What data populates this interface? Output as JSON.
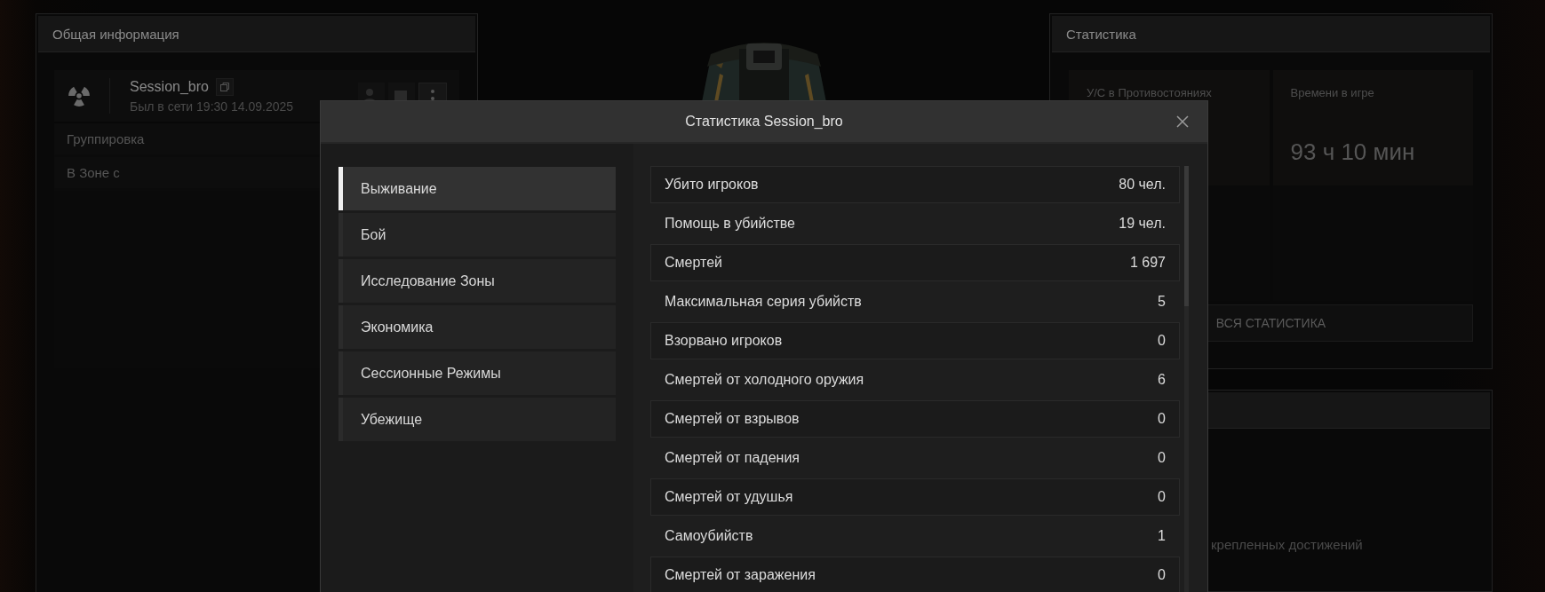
{
  "left_panel": {
    "title": "Общая информация",
    "profile": {
      "name": "Session_bro",
      "status": "Был в сети 19:30 14.09.2025"
    },
    "rows": [
      {
        "label": "Группировка"
      },
      {
        "label": "В Зоне с"
      }
    ]
  },
  "right_panel": {
    "title": "Статистика",
    "tiles": [
      {
        "label": "У/С в Противостояниях"
      },
      {
        "label": "Времени в игре",
        "value": "93 ч 10 мин"
      }
    ],
    "button": "ВСЯ СТАТИСТИКА"
  },
  "achievements_panel": {
    "text": "крепленных достижений"
  },
  "dialog": {
    "title": "Статистика Session_bro",
    "categories": [
      {
        "label": "Выживание",
        "selected": true
      },
      {
        "label": "Бой",
        "selected": false
      },
      {
        "label": "Исследование Зоны",
        "selected": false
      },
      {
        "label": "Экономика",
        "selected": false
      },
      {
        "label": "Сессионные Режимы",
        "selected": false
      },
      {
        "label": "Убежище",
        "selected": false
      }
    ],
    "stats": [
      {
        "label": "Убито игроков",
        "value": "80 чел."
      },
      {
        "label": "Помощь в убийстве",
        "value": "19 чел."
      },
      {
        "label": "Смертей",
        "value": "1 697"
      },
      {
        "label": "Максимальная серия убийств",
        "value": "5"
      },
      {
        "label": "Взорвано игроков",
        "value": "0"
      },
      {
        "label": "Смертей от холодного оружия",
        "value": "6"
      },
      {
        "label": "Смертей от взрывов",
        "value": "0"
      },
      {
        "label": "Смертей от падения",
        "value": "0"
      },
      {
        "label": "Смертей от удушья",
        "value": "0"
      },
      {
        "label": "Самоубийств",
        "value": "1"
      },
      {
        "label": "Смертей от заражения",
        "value": "0"
      }
    ]
  }
}
